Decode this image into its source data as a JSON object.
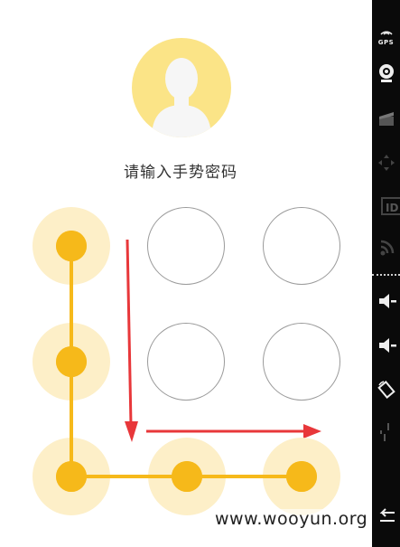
{
  "lock_screen": {
    "prompt": "请输入手势密码",
    "pattern_nodes_selected": [
      1,
      4,
      7,
      8,
      9
    ],
    "colors": {
      "avatar_bg": "#fbe487",
      "active_dot": "#f6b91a",
      "active_halo": "#fdefc8",
      "path": "#f6b91a",
      "arrow": "#e8373a"
    }
  },
  "sidebar": {
    "gps_label": "GPS",
    "id_label": "ID",
    "icons": [
      "gps-icon",
      "camera-icon",
      "clapper-icon",
      "dpad-icon",
      "id-icon",
      "rss-icon",
      "volume-down-icon",
      "volume-down-icon",
      "rotate-icon",
      "scale-icon",
      "back-icon"
    ]
  },
  "watermark": "www.wooyun.org"
}
